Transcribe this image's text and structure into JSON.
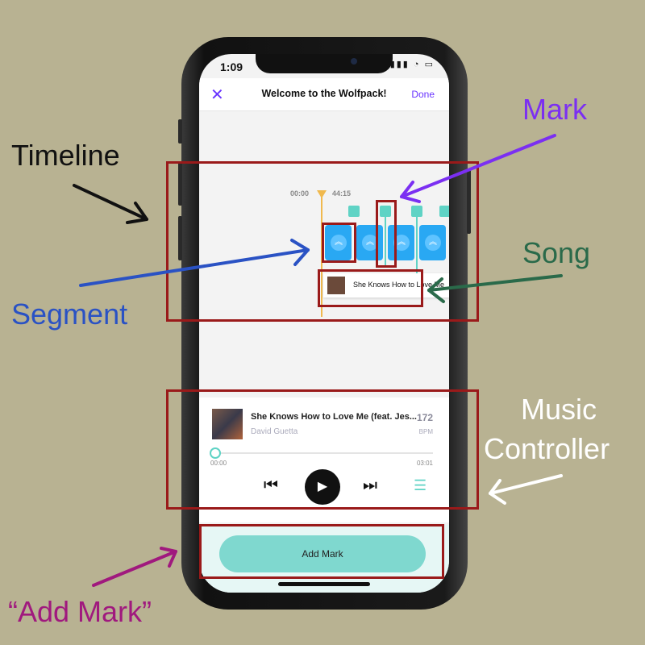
{
  "status": {
    "time": "1:09",
    "icons": "▮▮▮ ◔ ▭"
  },
  "nav": {
    "close": "✕",
    "title": "Welcome to the Wolfpack!",
    "done": "Done"
  },
  "timeline": {
    "start_time": "00:00",
    "marker_time": "44:15",
    "song_chip_title": "She Knows How to Love Me"
  },
  "controller": {
    "track_title": "She Knows How to Love Me (feat. Jes...",
    "artist": "David Guetta",
    "bpm_value": "172",
    "bpm_label": "BPM",
    "time_current": "00:00",
    "time_duration": "03:01",
    "progress_fraction": 0
  },
  "add_mark_button": "Add Mark",
  "annotations": {
    "timeline": "Timeline",
    "mark": "Mark",
    "song": "Song",
    "segment": "Segment",
    "music_controller_line1": "Music",
    "music_controller_line2": "Controller",
    "add_mark": "“Add Mark”"
  },
  "colors": {
    "background": "#b8b292",
    "accent_purple": "#6a35ff",
    "teal": "#5fd3c5",
    "segment_blue": "#29a8f3",
    "playhead": "#f0b94e",
    "annotation_box": "#9a1a1a",
    "timeline_label": "#111111",
    "mark_label": "#7b2ff2",
    "song_label": "#2a6a4a",
    "segment_label": "#2a52c4",
    "controller_label": "#ffffff",
    "add_mark_label": "#a0197e"
  }
}
